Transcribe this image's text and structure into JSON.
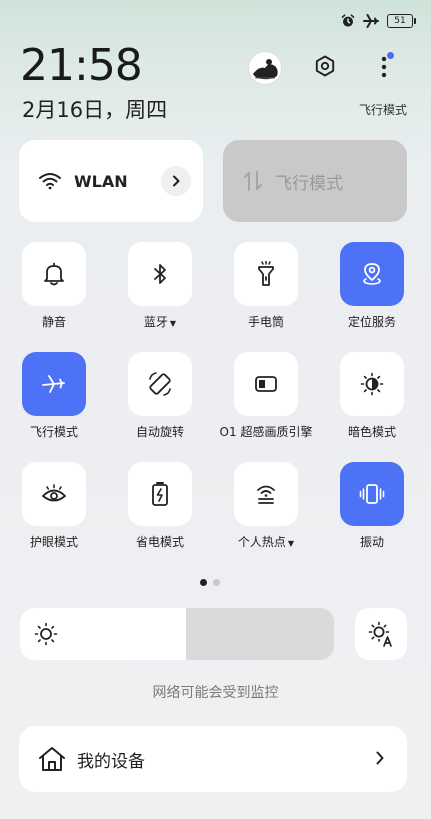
{
  "status_bar": {
    "battery": "51",
    "icons": [
      "alarm-icon",
      "airplane-icon",
      "battery-icon"
    ]
  },
  "header": {
    "time": "21:58",
    "date": "2月16日，周四",
    "airplane_mode_text": "飞行模式"
  },
  "wlan_tile": {
    "label": "WLAN",
    "icon": "wifi-icon"
  },
  "mobile_data_tile": {
    "label": "飞行模式",
    "icon": "data-arrows-icon",
    "disabled": true
  },
  "tiles": [
    {
      "label": "静音",
      "icon": "bell-icon",
      "active": false
    },
    {
      "label": "蓝牙",
      "icon": "bluetooth-icon",
      "active": false,
      "has_dropdown": true
    },
    {
      "label": "手电筒",
      "icon": "flashlight-icon",
      "active": false
    },
    {
      "label": "定位服务",
      "icon": "location-icon",
      "active": true
    },
    {
      "label": "飞行模式",
      "icon": "airplane-icon",
      "active": true
    },
    {
      "label": "自动旋转",
      "icon": "rotate-icon",
      "active": false
    },
    {
      "label": "O1 超感画质引擎",
      "icon": "display-engine-icon",
      "active": false
    },
    {
      "label": "暗色模式",
      "icon": "dark-mode-icon",
      "active": false
    },
    {
      "label": "护眼模式",
      "icon": "eye-icon",
      "active": false
    },
    {
      "label": "省电模式",
      "icon": "battery-saver-icon",
      "active": false
    },
    {
      "label": "个人热点",
      "icon": "hotspot-icon",
      "active": false,
      "has_dropdown": true
    },
    {
      "label": "振动",
      "icon": "vibrate-icon",
      "active": true
    }
  ],
  "pager": {
    "pages": 2,
    "current": 1
  },
  "brightness": {
    "level": 0.53
  },
  "notice": "网络可能会受到监控",
  "devices": {
    "label": "我的设备"
  },
  "colors": {
    "accent": "#4e72f5",
    "tile_bg": "#ffffff",
    "disabled_tile": "#c9c9c9"
  }
}
